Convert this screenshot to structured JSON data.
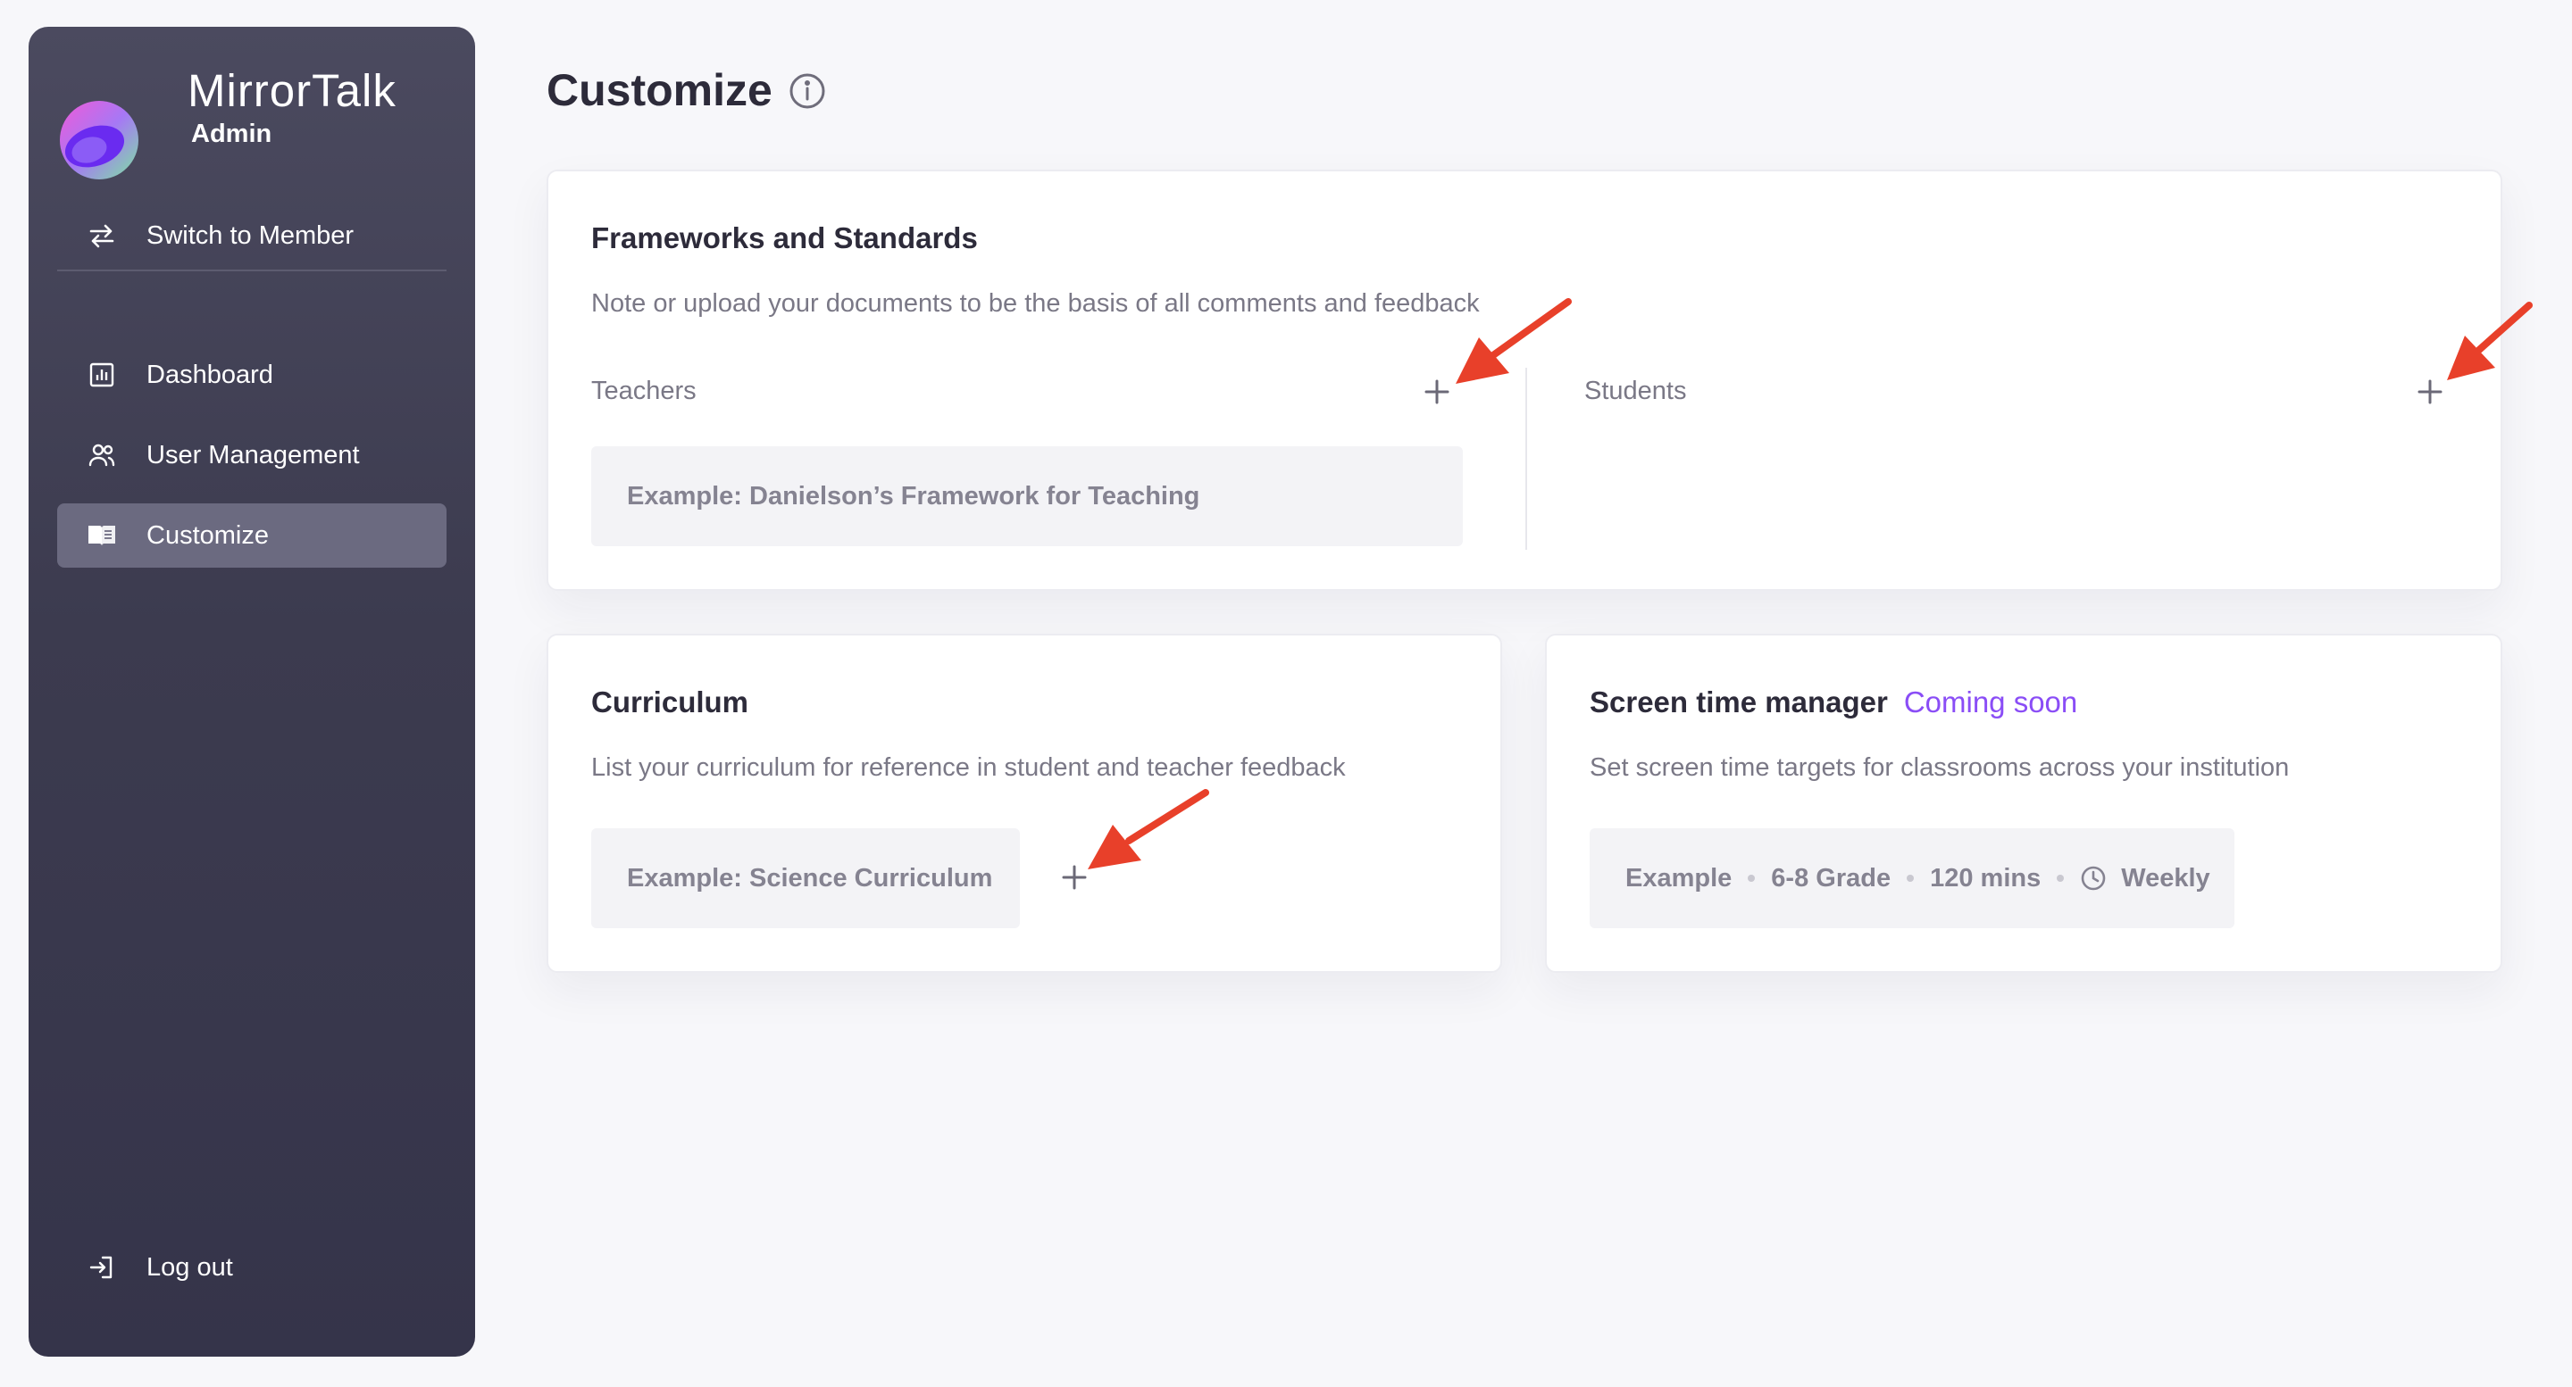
{
  "sidebar": {
    "brand_name": "MirrorTalk",
    "brand_role": "Admin",
    "switch_label": "Switch to Member",
    "items": [
      {
        "label": "Dashboard",
        "icon": "chart-icon"
      },
      {
        "label": "User Management",
        "icon": "users-icon"
      },
      {
        "label": "Customize",
        "icon": "book-icon",
        "active": true
      }
    ],
    "logout_label": "Log out"
  },
  "page": {
    "title": "Customize"
  },
  "frameworks": {
    "title": "Frameworks and Standards",
    "description": "Note or upload your documents to be the basis of all comments and feedback",
    "teachers_label": "Teachers",
    "teachers_example": "Example: Danielson’s Framework for Teaching",
    "students_label": "Students"
  },
  "curriculum": {
    "title": "Curriculum",
    "description": "List your curriculum for reference in student and teacher feedback",
    "example": "Example: Science Curriculum"
  },
  "screen_time": {
    "title": "Screen time manager",
    "badge": "Coming soon",
    "description": "Set screen time targets for classrooms across your institution",
    "example": {
      "prefix": "Example",
      "grade": "6-8 Grade",
      "duration": "120 mins",
      "frequency": "Weekly"
    }
  },
  "colors": {
    "accent": "#8a4df6",
    "annotation_arrow": "#e8402a",
    "sidebar": "#3c3b4f"
  }
}
